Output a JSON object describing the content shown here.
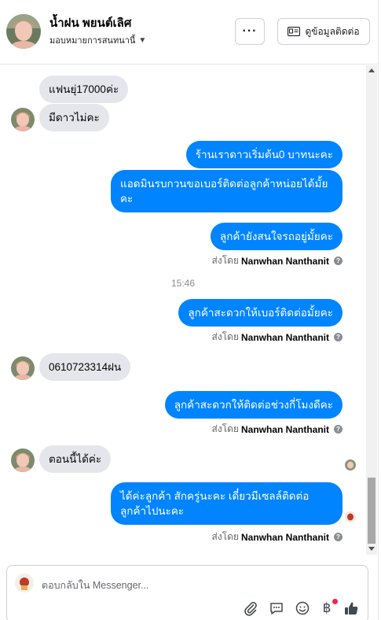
{
  "header": {
    "contact_name": "น้ำฝน พยนต์เลิศ",
    "assign_label": "มอบหมายการสนทนานี้",
    "more_label": "···",
    "contact_info_label": "ดูข้อมูลติดต่อ"
  },
  "messages": {
    "m1": "แฟนยุ่17000ค่ะ",
    "m2": "มีดาวไม่คะ",
    "m3": "ร้านเราดาวเริ่มต้น0 บาทนะคะ",
    "m4": "แอดมินรบกวนขอเบอร์ติดต่อลูกค้าหน่อยได้มั้ยคะ",
    "m5": "ลูกค้ายังสนใจรถอยู่มั้ยคะ",
    "m6": "ลูกค้าสะดวกให้เบอร์ติดต่อมั้ยคะ",
    "m7": "0610723314ฝน",
    "m8": "ลูกค้าสะดวกให้ติดต่อช่วงกี่โมงดีคะ",
    "m9": "ตอนนี้ได้ค่ะ",
    "m10": "ได้ค่ะลูกค้า สักครู่นะคะ เดี๋ยวมีเซลล์ติดต่อลูกค้าไปนะคะ"
  },
  "sent_by": {
    "prefix": "ส่งโดย",
    "agent": "Nanwhan Nanthanit"
  },
  "timestamp": "15:46",
  "composer": {
    "placeholder": "ตอบกลับใน Messenger...",
    "baht_symbol": "฿"
  },
  "icons": {
    "more": "more-dots-icon",
    "contact": "contact-card-icon",
    "attach": "paperclip-icon",
    "saved_replies": "chat-bubble-icon",
    "emoji": "smiley-icon",
    "payment": "baht-icon",
    "like": "thumbs-up-icon"
  },
  "colors": {
    "outgoing_bubble": "#0084ff",
    "incoming_bubble": "#e4e6eb",
    "notification_dot": "#f02849"
  }
}
